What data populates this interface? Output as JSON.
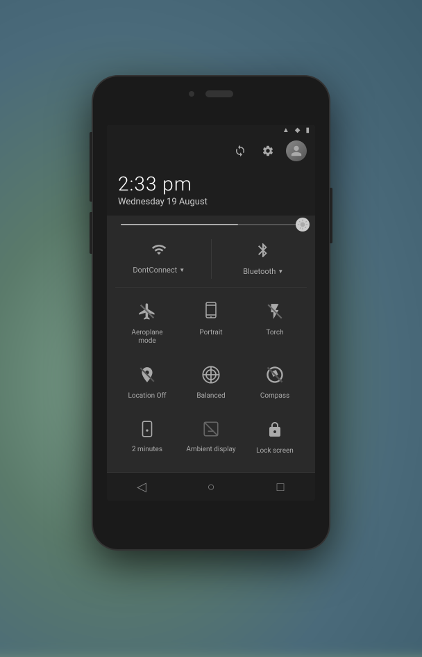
{
  "background": {
    "color": "#6b8a7a"
  },
  "phone": {
    "screen": {
      "statusBar": {
        "icons": [
          "signal",
          "wifi",
          "battery"
        ]
      },
      "headerIcons": {
        "icon1": "refresh",
        "icon2": "settings",
        "avatar": "user"
      },
      "time": {
        "display": "2:33 pm",
        "date": "Wednesday 19 August"
      },
      "brightnessSlider": {
        "label": "brightness",
        "value": 65
      },
      "connectivity": {
        "items": [
          {
            "label": "DontConnect",
            "hasDropdown": true,
            "icon": "wifi"
          },
          {
            "label": "Bluetooth",
            "hasDropdown": true,
            "icon": "bluetooth"
          }
        ]
      },
      "quickTiles": {
        "rows": [
          [
            {
              "id": "aeroplane",
              "label": "Aeroplane mode",
              "icon": "aeroplane"
            },
            {
              "id": "portrait",
              "label": "Portrait",
              "icon": "portrait"
            },
            {
              "id": "torch",
              "label": "Torch",
              "icon": "torch"
            }
          ],
          [
            {
              "id": "location-off",
              "label": "Location Off",
              "icon": "location-off"
            },
            {
              "id": "balanced",
              "label": "Balanced",
              "icon": "balanced"
            },
            {
              "id": "compass",
              "label": "Compass",
              "icon": "compass"
            }
          ],
          [
            {
              "id": "2min",
              "label": "2 minutes",
              "icon": "timer"
            },
            {
              "id": "ambient",
              "label": "Ambient display",
              "icon": "ambient"
            },
            {
              "id": "lockscreen",
              "label": "Lock screen",
              "icon": "lock"
            }
          ]
        ]
      },
      "bottomNav": {
        "back": "◁",
        "home": "○",
        "recent": "□"
      }
    }
  }
}
